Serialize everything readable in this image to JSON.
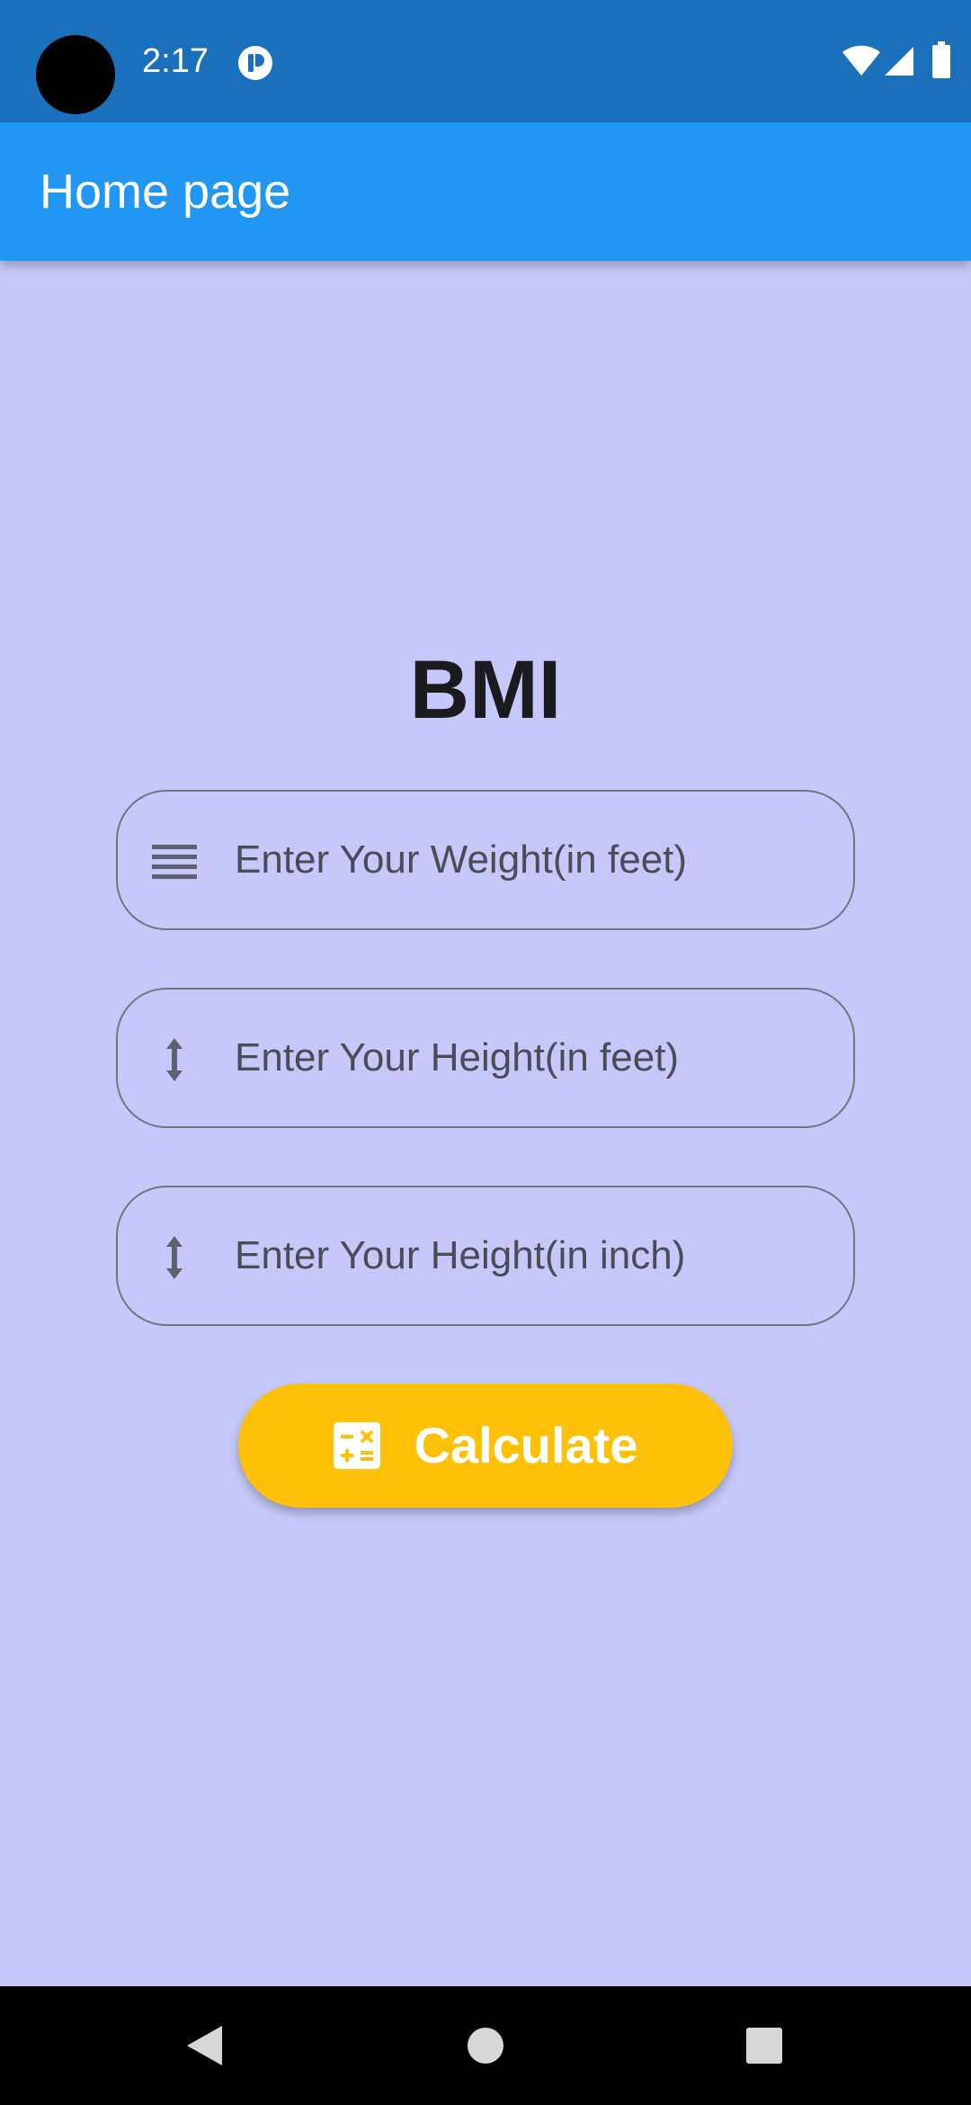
{
  "status_bar": {
    "time": "2:17",
    "icons": [
      "notification-icon",
      "wifi-icon",
      "signal-icon",
      "battery-icon"
    ]
  },
  "app_bar": {
    "title": "Home page"
  },
  "main": {
    "heading": "BMI",
    "fields": [
      {
        "icon": "weight-lines-icon",
        "placeholder": "Enter Your Weight(in feet)",
        "value": ""
      },
      {
        "icon": "height-arrow-icon",
        "placeholder": "Enter Your Height(in feet)",
        "value": ""
      },
      {
        "icon": "height-arrow-icon",
        "placeholder": "Enter Your Height(in inch)",
        "value": ""
      }
    ],
    "calculate_button": {
      "icon": "calculator-icon",
      "label": "Calculate"
    }
  },
  "nav_bar": {
    "buttons": [
      "back-icon",
      "home-icon",
      "recents-icon"
    ]
  },
  "colors": {
    "status_bar": "#1a70ba",
    "app_bar": "#2196f3",
    "background": "#c5c8f8",
    "button": "#ffc107",
    "field_border": "#74777f"
  }
}
